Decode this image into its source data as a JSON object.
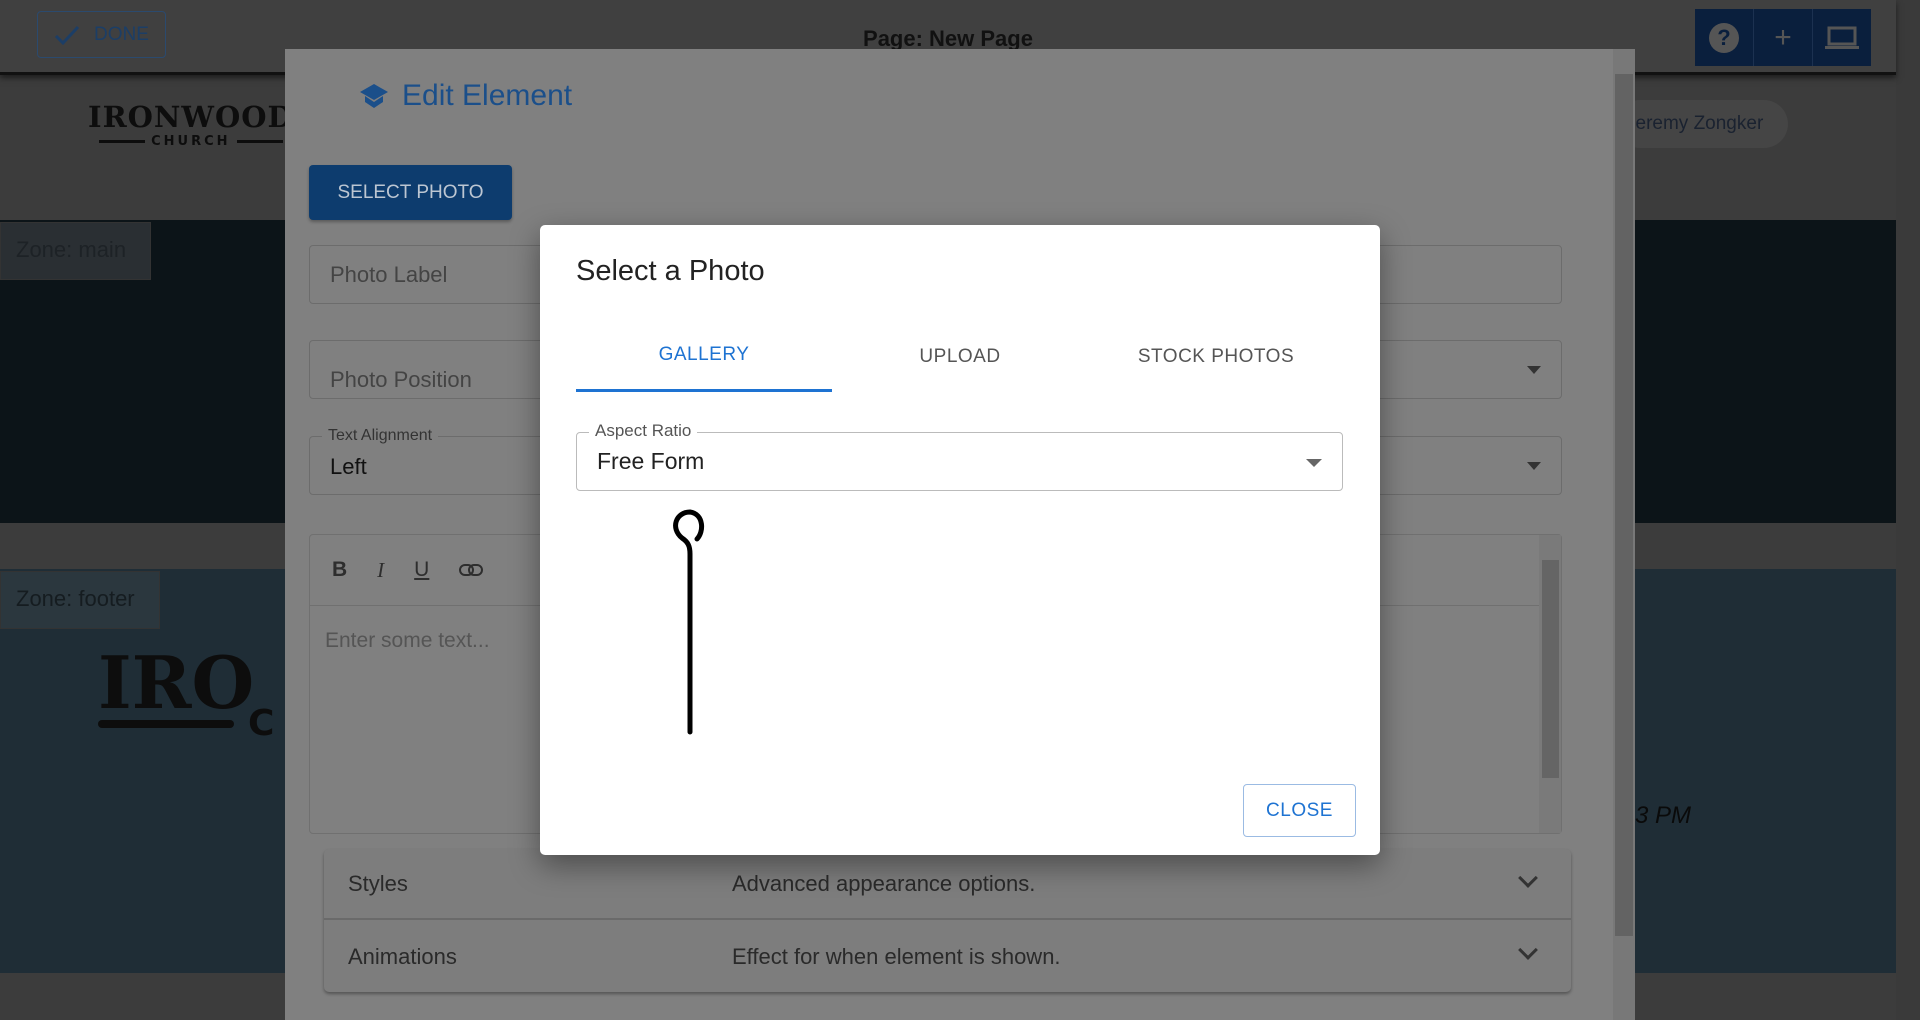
{
  "topbar": {
    "done_label": "DONE",
    "page_title": "Page: New Page",
    "icons": [
      "help-icon",
      "plus-icon",
      "laptop-icon"
    ]
  },
  "site": {
    "logo_text": "IRONWOOD",
    "logo_sub": "CHURCH",
    "user_name": "Jeremy Zongker",
    "zone_main": "Zone: main",
    "zone_footer": "Zone: footer",
    "footer_logo": "IRO",
    "footer_logo_sub": "C",
    "footer_time": "3 PM"
  },
  "edit_dialog": {
    "title": "Edit Element",
    "select_photo_label": "SELECT PHOTO",
    "photo_label_placeholder": "Photo Label",
    "photo_position_placeholder": "Photo Position",
    "text_alignment_label": "Text Alignment",
    "text_alignment_value": "Left",
    "editor_tools": {
      "bold": "B",
      "italic": "I",
      "underline": "U"
    },
    "editor_placeholder": "Enter some text...",
    "accordion": [
      {
        "title": "Styles",
        "desc": "Advanced appearance options."
      },
      {
        "title": "Animations",
        "desc": "Effect for when element is shown."
      }
    ]
  },
  "photo_dialog": {
    "title": "Select a Photo",
    "tabs": [
      {
        "label": "GALLERY",
        "active": true
      },
      {
        "label": "UPLOAD",
        "active": false
      },
      {
        "label": "STOCK PHOTOS",
        "active": false
      }
    ],
    "aspect_ratio_label": "Aspect Ratio",
    "aspect_ratio_value": "Free Form",
    "close_label": "CLOSE"
  },
  "colors": {
    "accent": "#1e73d2",
    "primary_button": "#0d3c6e"
  }
}
